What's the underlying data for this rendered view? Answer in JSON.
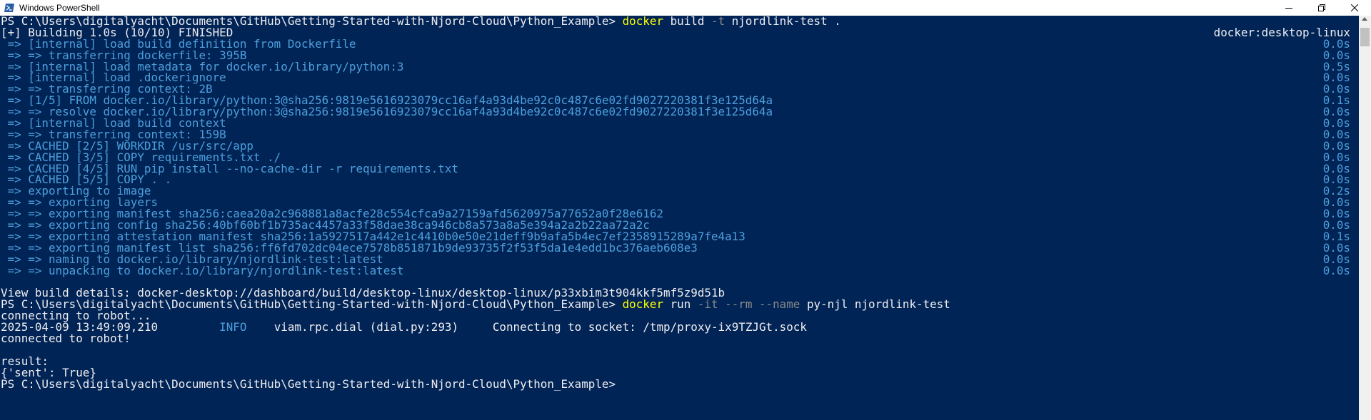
{
  "window": {
    "title": "Windows PowerShell",
    "icon": "powershell-icon",
    "controls": {
      "minimize": "minimize-icon",
      "maximize": "restore-icon",
      "close": "close-icon"
    }
  },
  "colors": {
    "console_bg": "#012456",
    "text": "#eeedf0",
    "build_text": "#4d9fdc",
    "command": "#ffff00",
    "flag": "#8a8a8a"
  },
  "lines": [
    {
      "kind": "cmd",
      "prompt": "PS C:\\Users\\digitalyacht\\Documents\\GitHub\\Getting-Started-with-Njord-Cloud\\Python_Example> ",
      "cmd": "docker",
      "a1": " build ",
      "flag": "-t",
      "a2": " njordlink-test ."
    },
    {
      "kind": "hdr",
      "text": "[+] Building 1.0s (10/10) FINISHED",
      "right": "docker:desktop-linux"
    },
    {
      "kind": "bk",
      "text": " => [internal] load build definition from Dockerfile",
      "right": "0.0s"
    },
    {
      "kind": "bk",
      "text": " => => transferring dockerfile: 395B",
      "right": "0.0s"
    },
    {
      "kind": "bk",
      "text": " => [internal] load metadata for docker.io/library/python:3",
      "right": "0.5s"
    },
    {
      "kind": "bk",
      "text": " => [internal] load .dockerignore",
      "right": "0.0s"
    },
    {
      "kind": "bk",
      "text": " => => transferring context: 2B",
      "right": "0.0s"
    },
    {
      "kind": "bk",
      "text": " => [1/5] FROM docker.io/library/python:3@sha256:9819e5616923079cc16af4a93d4be92c0c487c6e02fd9027220381f3e125d64a",
      "right": "0.1s"
    },
    {
      "kind": "bk",
      "text": " => => resolve docker.io/library/python:3@sha256:9819e5616923079cc16af4a93d4be92c0c487c6e02fd9027220381f3e125d64a",
      "right": "0.0s"
    },
    {
      "kind": "bk",
      "text": " => [internal] load build context",
      "right": "0.0s"
    },
    {
      "kind": "bk",
      "text": " => => transferring context: 159B",
      "right": "0.0s"
    },
    {
      "kind": "bk",
      "text": " => CACHED [2/5] WORKDIR /usr/src/app",
      "right": "0.0s"
    },
    {
      "kind": "bk",
      "text": " => CACHED [3/5] COPY requirements.txt ./",
      "right": "0.0s"
    },
    {
      "kind": "bk",
      "text": " => CACHED [4/5] RUN pip install --no-cache-dir -r requirements.txt",
      "right": "0.0s"
    },
    {
      "kind": "bk",
      "text": " => CACHED [5/5] COPY . .",
      "right": "0.0s"
    },
    {
      "kind": "bk",
      "text": " => exporting to image",
      "right": "0.2s"
    },
    {
      "kind": "bk",
      "text": " => => exporting layers",
      "right": "0.0s"
    },
    {
      "kind": "bk",
      "text": " => => exporting manifest sha256:caea20a2c968881a8acfe28c554cfca9a27159afd5620975a77652a0f28e6162",
      "right": "0.0s"
    },
    {
      "kind": "bk",
      "text": " => => exporting config sha256:40bf60bf1b735ac4457a33f58dae38ca946cb8a573a8a5e394a2a2b22aa72a2c",
      "right": "0.0s"
    },
    {
      "kind": "bk",
      "text": " => => exporting attestation manifest sha256:1a5927517a442e1c4410b0e50e21deff9b9afa5b4ec7ef2358915289a7fe4a13",
      "right": "0.1s"
    },
    {
      "kind": "bk",
      "text": " => => exporting manifest list sha256:ff6fd702dc04ece7578b851871b9de93735f2f53f5da1e4edd1bc376aeb608e3",
      "right": "0.0s"
    },
    {
      "kind": "bk",
      "text": " => => naming to docker.io/library/njordlink-test:latest",
      "right": "0.0s"
    },
    {
      "kind": "bk",
      "text": " => => unpacking to docker.io/library/njordlink-test:latest",
      "right": "0.0s"
    },
    {
      "kind": "plain",
      "text": ""
    },
    {
      "kind": "plain",
      "text": "View build details: docker-desktop://dashboard/build/desktop-linux/desktop-linux/p33xbim3t904kkf5mf5z9d51b"
    },
    {
      "kind": "cmd",
      "prompt": "PS C:\\Users\\digitalyacht\\Documents\\GitHub\\Getting-Started-with-Njord-Cloud\\Python_Example> ",
      "cmd": "docker",
      "a1": " run ",
      "flag": "-it --rm --name",
      "a2": " py-njl njordlink-test"
    },
    {
      "kind": "plain",
      "text": "connecting to robot..."
    },
    {
      "kind": "log",
      "pre": "2025-04-09 13:49:09,210         ",
      "level": "INFO",
      "post": "    viam.rpc.dial (dial.py:293)     Connecting to socket: /tmp/proxy-ix9TZJGt.sock"
    },
    {
      "kind": "plain",
      "text": "connected to robot!"
    },
    {
      "kind": "plain",
      "text": ""
    },
    {
      "kind": "plain",
      "text": "result:"
    },
    {
      "kind": "plain",
      "text": "{'sent': True}"
    },
    {
      "kind": "plain",
      "text": "PS C:\\Users\\digitalyacht\\Documents\\GitHub\\Getting-Started-with-Njord-Cloud\\Python_Example>"
    }
  ]
}
